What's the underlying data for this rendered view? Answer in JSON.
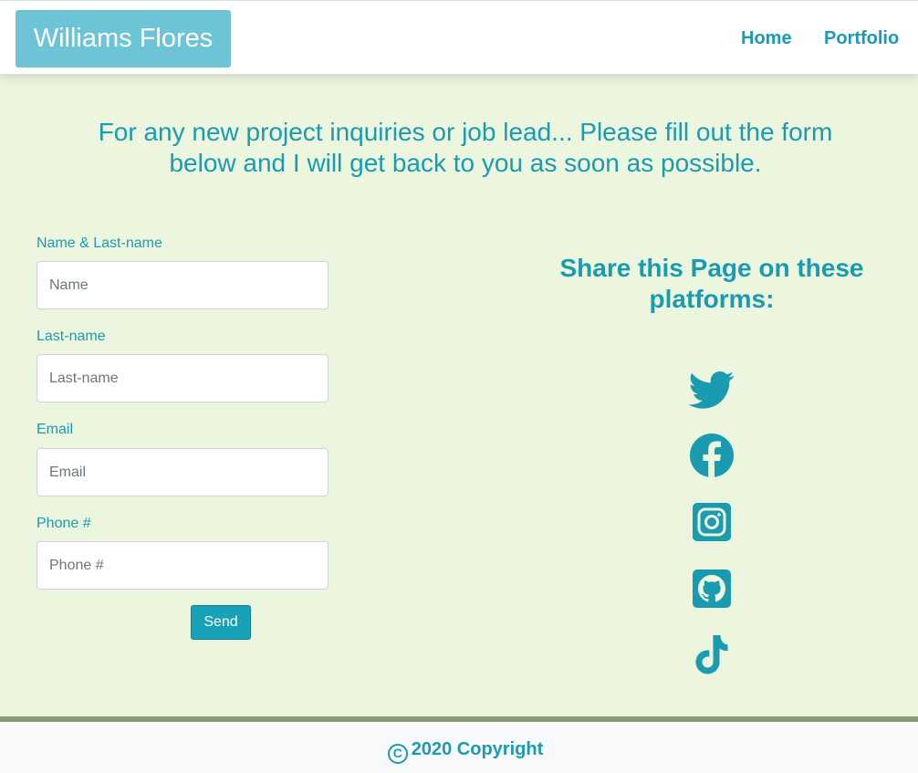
{
  "header": {
    "brand": "Williams Flores",
    "nav": {
      "home": "Home",
      "portfolio": "Portfolio"
    }
  },
  "main": {
    "intro": "For any new project inquiries or job lead... Please fill out the form below and I will get back to you as soon as possible.",
    "form": {
      "name_label": "Name & Last-name",
      "name_placeholder": "Name",
      "lastname_label": "Last-name",
      "lastname_placeholder": "Last-name",
      "email_label": "Email",
      "email_placeholder": "Email",
      "phone_label": "Phone #",
      "phone_placeholder": "Phone #",
      "send_label": "Send"
    },
    "share": {
      "title": "Share this Page on these platforms:",
      "icons": [
        "twitter-icon",
        "facebook-icon",
        "instagram-icon",
        "github-icon",
        "tiktok-icon"
      ]
    }
  },
  "footer": {
    "copyright_symbol": "C",
    "copyright": "2020 Copyright"
  },
  "colors": {
    "accent": "#1a9bb0",
    "brand_bg": "#6cc4d6",
    "main_bg": "#ecf5de",
    "footer_bg": "#f8f9fa",
    "footer_border": "#8a9a74",
    "button_bg": "#17a2b8"
  }
}
